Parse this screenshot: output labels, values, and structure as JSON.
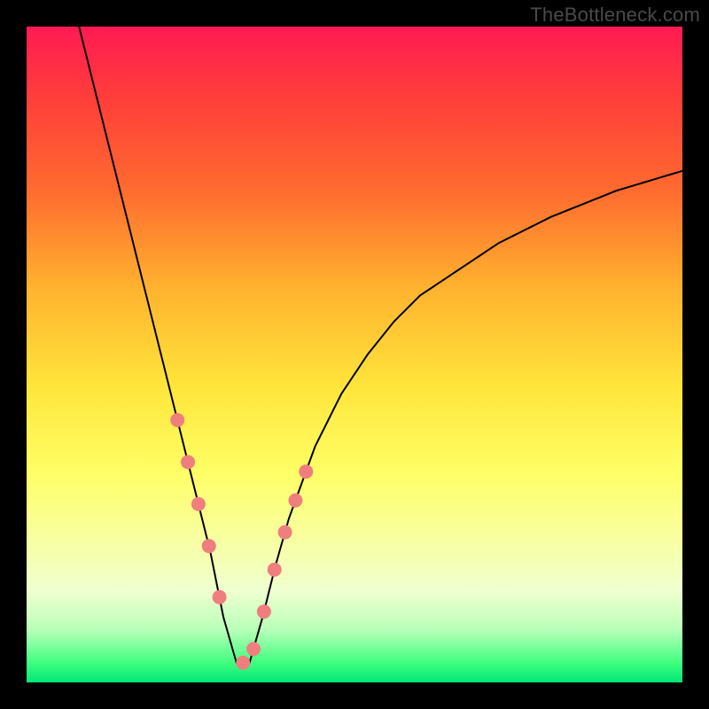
{
  "watermark": "TheBottleneck.com",
  "colors": {
    "curve": "#000000",
    "dot": "#ef7f7f"
  },
  "chart_data": {
    "type": "line",
    "title": "",
    "xlabel": "",
    "ylabel": "",
    "xlim": [
      0,
      100
    ],
    "ylim": [
      0,
      100
    ],
    "x_valley": 32,
    "series": [
      {
        "name": "bottleneck-curve",
        "x": [
          8,
          10,
          12,
          14,
          16,
          18,
          20,
          22,
          24,
          26,
          28,
          30,
          32,
          34,
          36,
          38,
          40,
          44,
          48,
          52,
          56,
          60,
          66,
          72,
          80,
          90,
          100
        ],
        "y": [
          100,
          92,
          84,
          76,
          68,
          60,
          52,
          44,
          36,
          28,
          20,
          10,
          3,
          3,
          10,
          18,
          25,
          36,
          44,
          50,
          55,
          59,
          63,
          67,
          71,
          75,
          78
        ]
      }
    ],
    "highlight_ranges_x": [
      [
        23,
        31
      ],
      [
        33,
        44
      ]
    ],
    "dot_radius": 1.1
  }
}
